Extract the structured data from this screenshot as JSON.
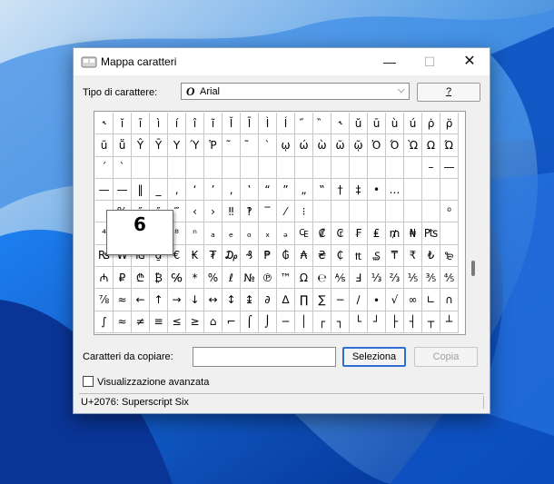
{
  "window": {
    "title": "Mappa caratteri"
  },
  "titlebar": {
    "minimize": "—",
    "maximize": "☐",
    "close": "✕"
  },
  "font_picker": {
    "label": "Tipo di carattere:",
    "icon": "O",
    "value": "Arial",
    "chevron": "⌵"
  },
  "help_button": {
    "label": "?"
  },
  "grid": {
    "rows": [
      [
        "˞",
        "ĭ",
        "ī",
        "ì",
        "í",
        "î",
        "ĩ",
        "Ĭ",
        "Ī",
        "Ì",
        "Í",
        "̋",
        "̏",
        "˞",
        "ŭ",
        "ū",
        "ù",
        "ú",
        "ρ̇",
        "ρ̈"
      ],
      [
        "ũ",
        "ṻ",
        "Ŷ",
        "Ȳ",
        "Υ",
        "Ύ",
        "Ῥ",
        "̃",
        "̃",
        "`",
        "ῳ",
        "ώ",
        "ὼ",
        "ῶ",
        "ῷ",
        "Ὀ",
        "Ό",
        "Ὼ",
        "Ω",
        "Ώ"
      ],
      [
        "ˊ",
        "ˋ",
        "",
        "",
        "",
        "",
        "",
        "",
        "",
        "",
        "",
        "",
        "",
        "",
        "",
        "",
        "",
        "",
        "–",
        "—"
      ],
      [
        "—",
        "—",
        "‖",
        "_",
        "‚",
        "‘",
        "’",
        "‚",
        "‛",
        "“",
        "”",
        "„",
        "‟",
        "†",
        "‡",
        "•",
        "…",
        "",
        "",
        ""
      ],
      [
        "",
        "%",
        "″",
        "″",
        "‴",
        "‹",
        "›",
        "‼",
        "‽",
        "‾",
        "⁄",
        "⁝",
        "",
        "",
        "",
        "",
        "",
        "",
        "",
        "⁰"
      ],
      [
        "⁴",
        "",
        "",
        "",
        "⁸",
        "ⁿ",
        "ₐ",
        "ₑ",
        "ₒ",
        "ₓ",
        "ₔ",
        "₠",
        "₡",
        "₢",
        "₣",
        "₤",
        "₥",
        "₦",
        "₧",
        ""
      ],
      [
        "₨",
        "₩",
        "₪",
        "₫",
        "€",
        "₭",
        "₮",
        "₯",
        "₰",
        "₱",
        "₲",
        "₳",
        "₴",
        "₵",
        "₶",
        "₷",
        "₸",
        "₹",
        "₺",
        "₻"
      ],
      [
        "₼",
        "₽",
        "₾",
        "₿",
        "℅",
        "*",
        "%",
        "ℓ",
        "№",
        "℗",
        "™",
        "Ω",
        "℮",
        "⅍",
        "Ⅎ",
        "⅓",
        "⅔",
        "⅕",
        "⅗",
        "⅘"
      ],
      [
        "⅞",
        "≈",
        "←",
        "↑",
        "→",
        "↓",
        "↔",
        "↕",
        "↨",
        "∂",
        "∆",
        "∏",
        "∑",
        "−",
        "∕",
        "∙",
        "√",
        "∞",
        "∟",
        "∩"
      ],
      [
        "∫",
        "≈",
        "≠",
        "≡",
        "≤",
        "≥",
        "⌂",
        "⌐",
        "⌠",
        "⌡",
        "─",
        "│",
        "┌",
        "┐",
        "└",
        "┘",
        "├",
        "┤",
        "┬",
        "┴"
      ]
    ],
    "zoom_char": "6"
  },
  "copy": {
    "label": "Caratteri da copiare:",
    "value": "",
    "select_button": "Seleziona",
    "copy_button": "Copia"
  },
  "advanced": {
    "label": "Visualizzazione avanzata",
    "checked": false
  },
  "status": {
    "text": "U+2076: Superscript Six"
  }
}
